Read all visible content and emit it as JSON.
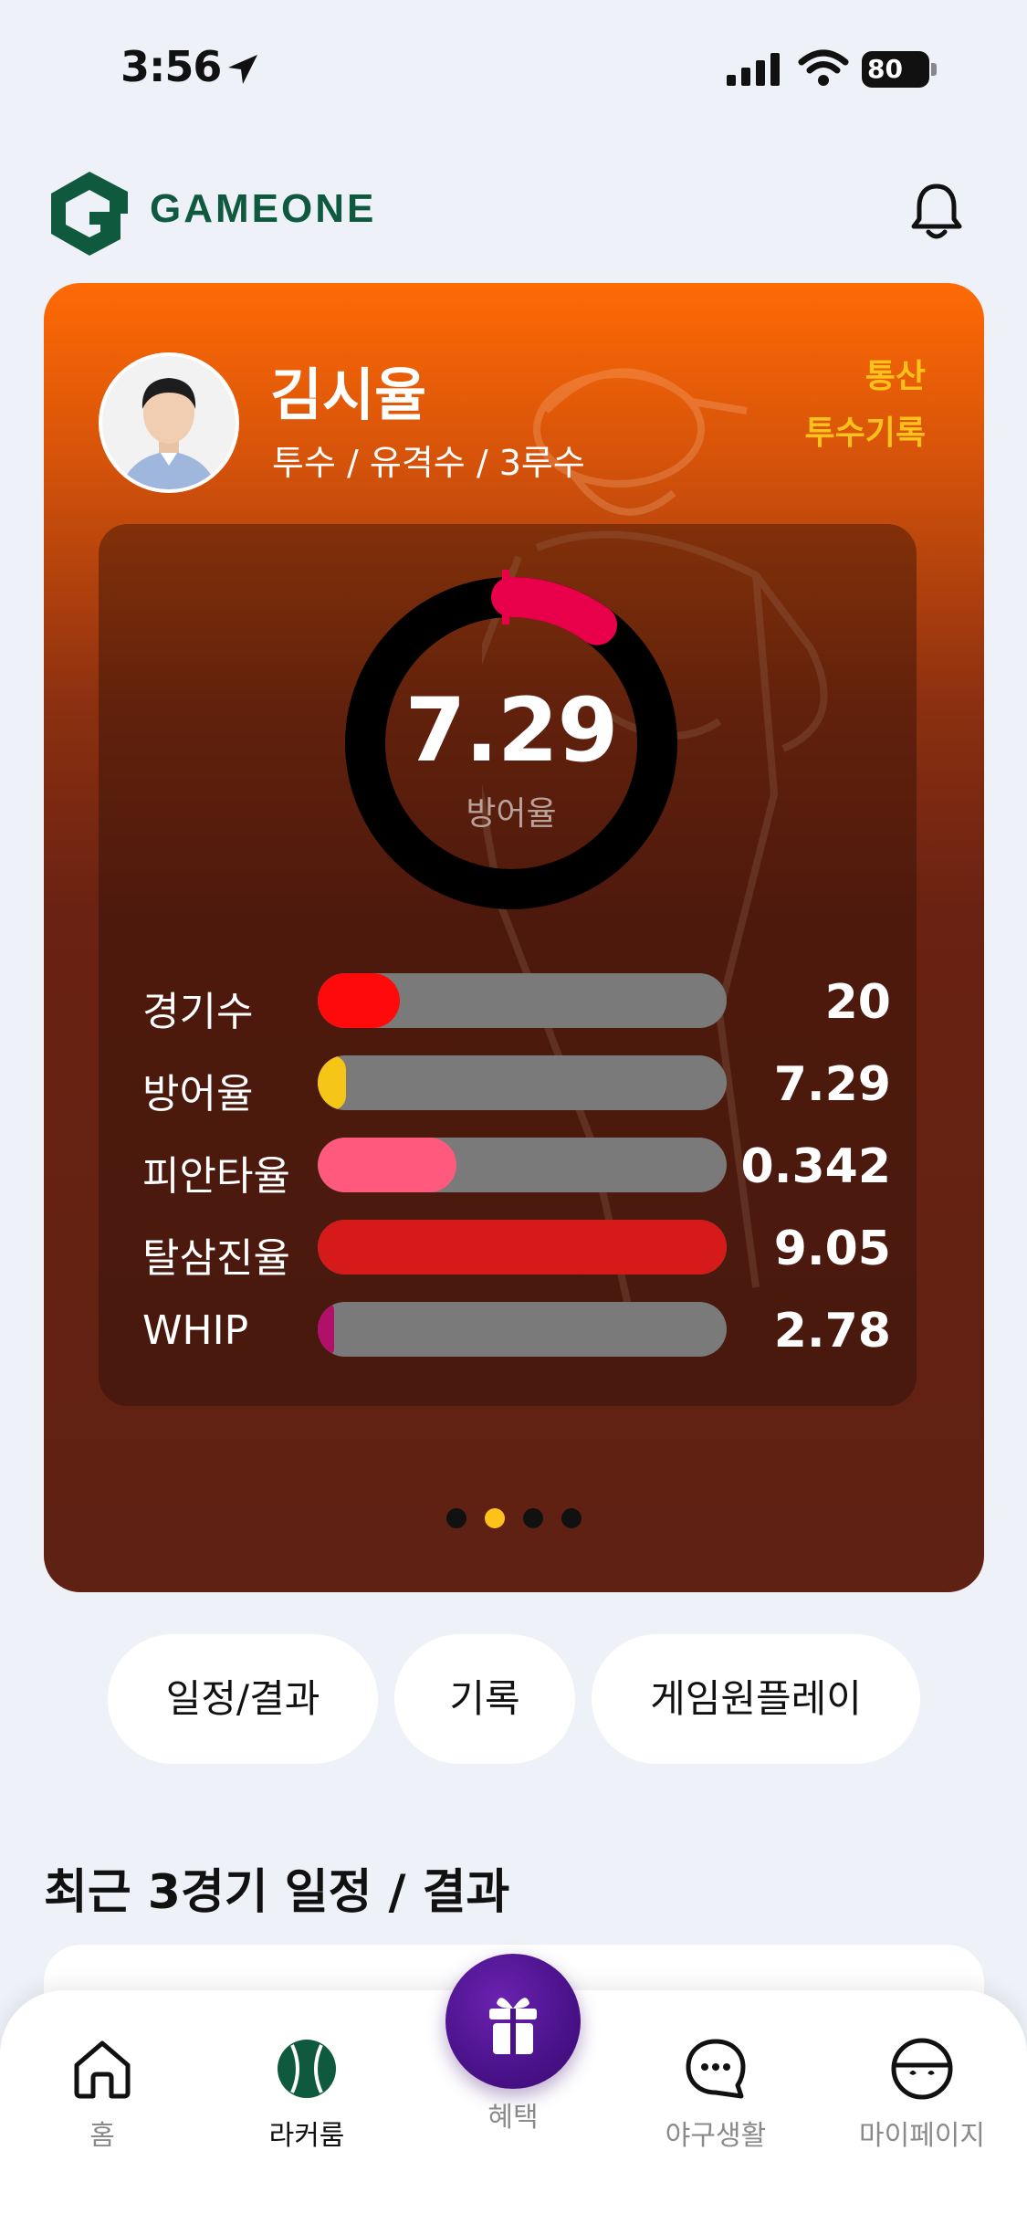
{
  "status_bar": {
    "time": "3:56",
    "battery": "80"
  },
  "header": {
    "logo_text": "GAMEONE"
  },
  "player": {
    "name": "김시율",
    "positions": "투수 / 유격수 / 3루수",
    "record_link_line1": "통산",
    "record_link_line2": "투수기록",
    "era_value": "7.29",
    "era_label": "방어율",
    "era_gauge_fraction": 0.1,
    "stats": [
      {
        "label": "경기수",
        "value": "20",
        "fill_fraction": 0.2,
        "color": "#ff0a0a"
      },
      {
        "label": "방어율",
        "value": "7.29",
        "fill_fraction": 0.07,
        "color": "#f5c518"
      },
      {
        "label": "피안타율",
        "value": "0.342",
        "fill_fraction": 0.34,
        "color": "#ff5a7e"
      },
      {
        "label": "탈삼진율",
        "value": "9.05",
        "fill_fraction": 1.0,
        "color": "#d61a1a"
      },
      {
        "label": "WHIP",
        "value": "2.78",
        "fill_fraction": 0.03,
        "color": "#b0106a"
      }
    ],
    "pager": {
      "total": 4,
      "active_index": 1
    }
  },
  "quick_menu": [
    "일정/결과",
    "기록",
    "게임원플레이"
  ],
  "section": {
    "recent_title": "최근 3경기 일정 / 결과"
  },
  "tabs": {
    "home": "홈",
    "locker": "라커룸",
    "benefit": "혜택",
    "baseball_life": "야구생활",
    "mypage": "마이페이지"
  },
  "colors": {
    "brand_green": "#0f5a3f",
    "accent_yellow": "#ffc21a",
    "gauge_pink": "#e8004a",
    "benefit_purple": "#4a128a"
  }
}
